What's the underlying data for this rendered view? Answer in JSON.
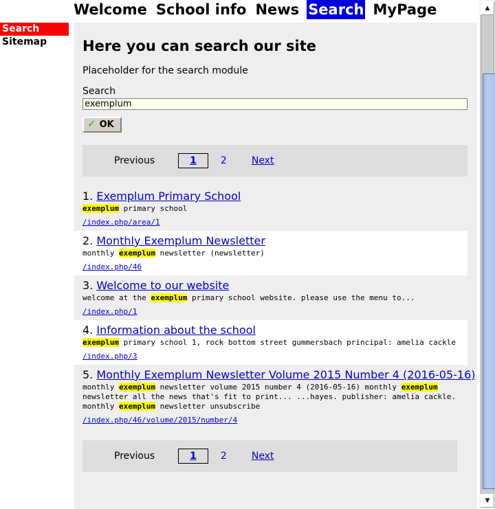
{
  "nav": {
    "items": [
      {
        "label": "Welcome",
        "active": false
      },
      {
        "label": "School info",
        "active": false
      },
      {
        "label": "News",
        "active": false
      },
      {
        "label": "Search",
        "active": true
      },
      {
        "label": "MyPage",
        "active": false
      }
    ]
  },
  "sidebar": {
    "items": [
      {
        "label": "Search",
        "active": true
      },
      {
        "label": "Sitemap",
        "active": false
      }
    ]
  },
  "main": {
    "page_title": "Here you can search our site",
    "placeholder_text": "Placeholder for the search module"
  },
  "search": {
    "label": "Search",
    "value": "exemplum",
    "placeholder": "",
    "submit_label": "OK",
    "submit_icon": "check-icon"
  },
  "pager": {
    "previous_label": "Previous",
    "next_label": "Next",
    "pages": [
      "1",
      "2"
    ],
    "current_page": "1"
  },
  "results": [
    {
      "rank": "1.",
      "title": "Exemplum Primary School",
      "desc_parts": [
        {
          "text": "exemplum",
          "hl": true
        },
        {
          "text": " primary school",
          "hl": false
        }
      ],
      "url": "/index.php/area/1"
    },
    {
      "rank": "2.",
      "title": "Monthly Exemplum Newsletter",
      "desc_parts": [
        {
          "text": "monthly ",
          "hl": false
        },
        {
          "text": "exemplum",
          "hl": true
        },
        {
          "text": " newsletter (newsletter)",
          "hl": false
        }
      ],
      "url": "/index.php/46"
    },
    {
      "rank": "3.",
      "title": "Welcome to our website",
      "desc_parts": [
        {
          "text": "welcome at the ",
          "hl": false
        },
        {
          "text": "exemplum",
          "hl": true
        },
        {
          "text": " primary school website. please use the menu to...",
          "hl": false
        }
      ],
      "url": "/index.php/1"
    },
    {
      "rank": "4.",
      "title": "Information about the school",
      "desc_parts": [
        {
          "text": "exemplum",
          "hl": true
        },
        {
          "text": " primary school 1, rock bottom street gummersbach principal: amelia cackle",
          "hl": false
        }
      ],
      "url": "/index.php/3"
    },
    {
      "rank": "5.",
      "title": "Monthly Exemplum Newsletter Volume 2015 Number 4 (2016-05-16)",
      "desc_parts": [
        {
          "text": "monthly ",
          "hl": false
        },
        {
          "text": "exemplum",
          "hl": true
        },
        {
          "text": " newsletter volume 2015 number 4 (2016-05-16) monthly ",
          "hl": false
        },
        {
          "text": "exemplum",
          "hl": true
        },
        {
          "text": " newsletter all the news that's fit to print... ...hayes. publisher: amelia cackle. monthly ",
          "hl": false
        },
        {
          "text": "exemplum",
          "hl": true
        },
        {
          "text": " newsletter unsubscribe",
          "hl": false
        }
      ],
      "url": "/index.php/46/volume/2015/number/4"
    }
  ],
  "scrollbar": {
    "up_arrow": "▲",
    "down_arrow": "▼"
  },
  "colors": {
    "nav_active_bg": "#0000dd",
    "sidebar_active_bg": "#ff0000",
    "link": "#0000cc",
    "highlight": "#ffff00",
    "panel_bg": "#eeeeee",
    "pager_bg": "#dddddd",
    "input_bg": "#ffffee"
  }
}
